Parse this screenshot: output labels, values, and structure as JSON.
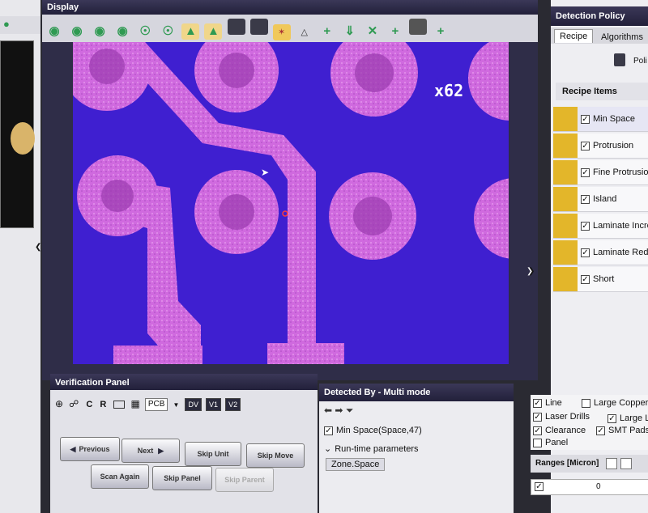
{
  "display": {
    "title": "Display",
    "zoom_label": "x62"
  },
  "detection_policy": {
    "title": "Detection Policy",
    "tabs": [
      "Recipe",
      "Algorithms"
    ],
    "policy_label": "Poli",
    "recipe_items_title": "Recipe Items",
    "recipe_items": [
      {
        "label": "Min Space",
        "checked": true
      },
      {
        "label": "Protrusion",
        "checked": true
      },
      {
        "label": "Fine Protrusion",
        "checked": true
      },
      {
        "label": "Island",
        "checked": true
      },
      {
        "label": "Laminate Increas",
        "checked": true
      },
      {
        "label": "Laminate Reductio",
        "checked": true
      },
      {
        "label": "Short",
        "checked": true
      }
    ],
    "layers": {
      "line": "Line",
      "large_copper": "Large Copper",
      "laser_drills": "Laser Drills",
      "large_la": "Large La",
      "clearance": "Clearance",
      "smt_pads": "SMT Pads",
      "panel": "Panel"
    },
    "ranges_title": "Ranges [Micron]",
    "range_value": "0"
  },
  "verification_panel": {
    "title": "Verification Panel",
    "toolbar": {
      "c": "C",
      "r": "R",
      "pcb_select": "PCB",
      "dv": "DV",
      "v1": "V1",
      "v2": "V2"
    },
    "buttons": {
      "previous": "Previous",
      "next": "Next",
      "skip_unit": "Skip Unit",
      "skip_move": "Skip Move",
      "scan_again": "Scan Again",
      "skip_panel": "Skip Panel",
      "skip_parent": "Skip Parent"
    }
  },
  "detected_by": {
    "title": "Detected By  - Multi mode",
    "item": "Min Space(Space,47)",
    "runtime": "Run-time parameters",
    "zone": "Zone.Space"
  },
  "colors": {
    "board_blue": "#3f1fd0",
    "copper_pink": "#d06adf",
    "header_dark": "#2b2944",
    "recipe_thumb": "#e3b62a"
  }
}
